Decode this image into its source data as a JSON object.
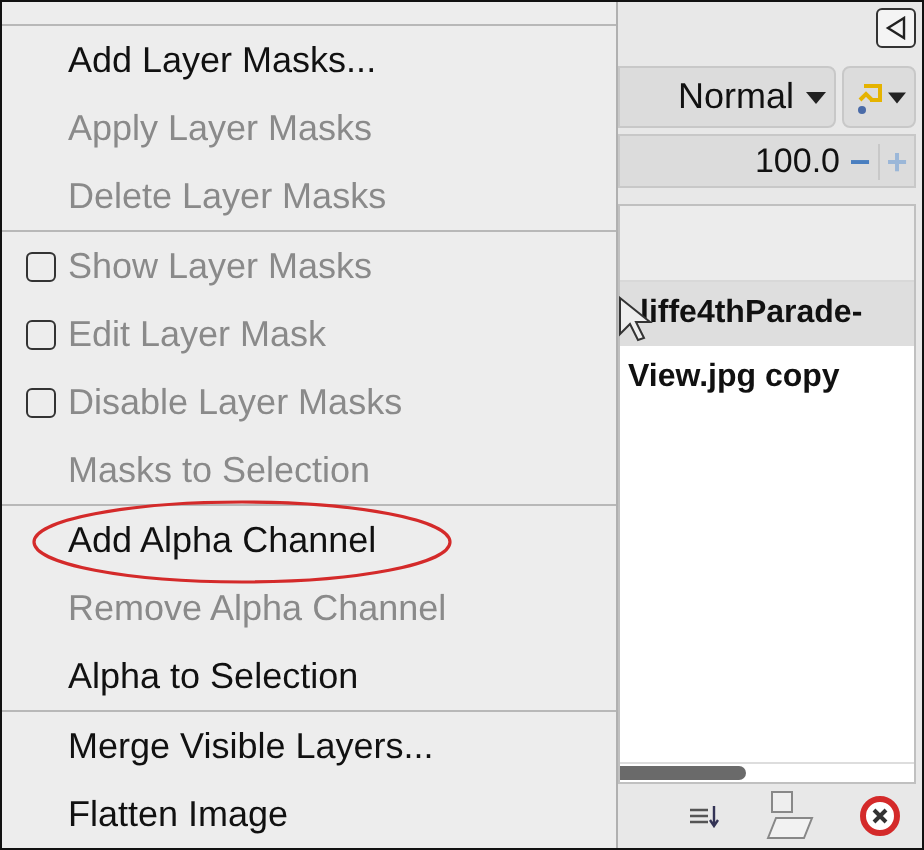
{
  "menu": {
    "items": [
      {
        "kind": "separator"
      },
      {
        "kind": "item",
        "label": "Add Layer Masks...",
        "disabled": false
      },
      {
        "kind": "item",
        "label": "Apply Layer Masks",
        "disabled": true
      },
      {
        "kind": "item",
        "label": "Delete Layer Masks",
        "disabled": true
      },
      {
        "kind": "separator"
      },
      {
        "kind": "checkbox",
        "label": "Show Layer Masks",
        "disabled": true,
        "checked": false
      },
      {
        "kind": "checkbox",
        "label": "Edit Layer Mask",
        "disabled": true,
        "checked": false
      },
      {
        "kind": "checkbox",
        "label": "Disable Layer Masks",
        "disabled": true,
        "checked": false
      },
      {
        "kind": "item",
        "label": "Masks to Selection",
        "disabled": true
      },
      {
        "kind": "separator"
      },
      {
        "kind": "item",
        "label": "Add Alpha Channel",
        "disabled": false,
        "circled": true
      },
      {
        "kind": "item",
        "label": "Remove Alpha Channel",
        "disabled": true
      },
      {
        "kind": "item",
        "label": "Alpha to Selection",
        "disabled": false
      },
      {
        "kind": "separator"
      },
      {
        "kind": "item",
        "label": "Merge Visible Layers...",
        "disabled": false
      },
      {
        "kind": "item",
        "label": "Flatten Image",
        "disabled": false
      }
    ]
  },
  "layers_panel": {
    "mode": "Normal",
    "opacity": "100.0",
    "minus": "−",
    "plus": "+",
    "layers": [
      {
        "name": "liffe4thParade-",
        "selected": true
      },
      {
        "name": "View.jpg copy",
        "selected": false
      }
    ]
  }
}
